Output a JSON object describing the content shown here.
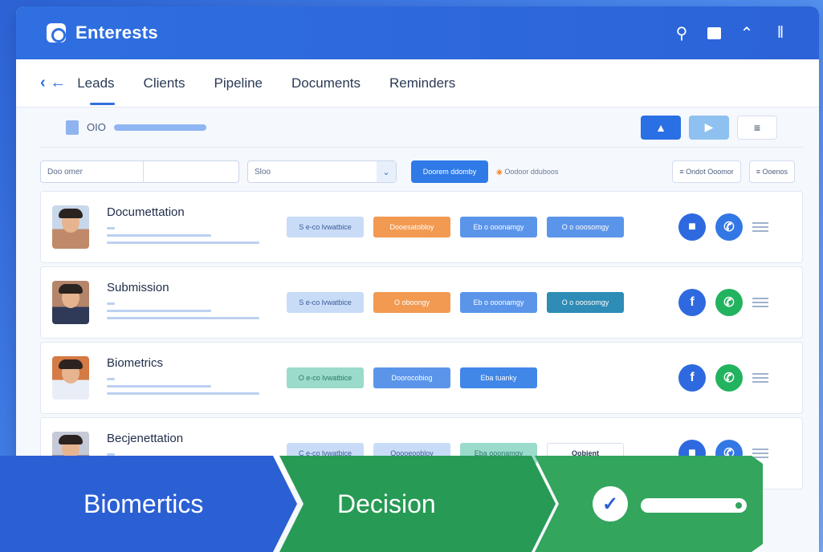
{
  "app": {
    "title": "Enterests"
  },
  "titlebar_icons": [
    "search-icon",
    "square-icon",
    "chart-icon",
    "pause-icon"
  ],
  "nav": {
    "tabs": [
      {
        "label": "Leads",
        "active": true
      },
      {
        "label": "Clients"
      },
      {
        "label": "Pipeline"
      },
      {
        "label": "Documents"
      },
      {
        "label": "Reminders"
      }
    ]
  },
  "toolbar": {
    "label": "OIO"
  },
  "filters": {
    "search_value": "Doo omer",
    "select_value": "Sloo",
    "primary_button": "Doorem ddomby",
    "note": "Oodoor dduboos",
    "chip1": "Ondot Ooomor",
    "chip2": "Ooenos"
  },
  "rows": [
    {
      "name": "Documettation",
      "tags": [
        "S e-co lvwatbice",
        "Dooesatobloy",
        "Eb o ooonamgy",
        "O o ooosomgy"
      ]
    },
    {
      "name": "Submission",
      "tags": [
        "S e-co lvwatbice",
        "O oboongy",
        "Eb o ooonamgy",
        "O o ooosomgy"
      ]
    },
    {
      "name": "Biometrics",
      "tags": [
        "O e-co lvwatbice",
        "Doorocobiog",
        "Eba tuanky"
      ]
    },
    {
      "name": "Becjenettation",
      "tags": [
        "C e-co lvwatbice",
        "Ooooeoobloy",
        "Eba ooonamgy"
      ],
      "extra": "Oobient"
    }
  ],
  "process": {
    "steps": [
      "Biomertics",
      "Decision"
    ]
  }
}
